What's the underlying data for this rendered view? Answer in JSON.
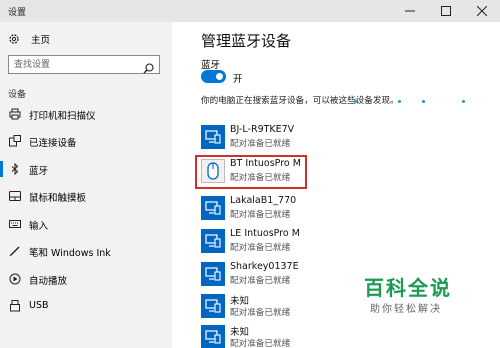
{
  "window": {
    "title": "设置"
  },
  "sidebar": {
    "home_label": "主页",
    "search_placeholder": "查找设置",
    "section_label": "设备",
    "items": [
      {
        "label": "打印机和扫描仪",
        "icon": "printer-icon"
      },
      {
        "label": "已连接设备",
        "icon": "connected-devices-icon"
      },
      {
        "label": "蓝牙",
        "icon": "bluetooth-icon",
        "active": true
      },
      {
        "label": "鼠标和触摸板",
        "icon": "mouse-touchpad-icon"
      },
      {
        "label": "输入",
        "icon": "keyboard-icon"
      },
      {
        "label": "笔和 Windows Ink",
        "icon": "pen-icon"
      },
      {
        "label": "自动播放",
        "icon": "autoplay-icon"
      },
      {
        "label": "USB",
        "icon": "usb-icon"
      }
    ]
  },
  "main": {
    "heading": "管理蓝牙设备",
    "bluetooth_label": "蓝牙",
    "toggle_state": "开",
    "toggle_on": true,
    "description": "你的电脑正在搜索蓝牙设备，可以被这些设备发现。",
    "devices": [
      {
        "name": "BJ-L-R9TKE7V",
        "status": "配对准备已就绪",
        "icon": "computer-device-icon"
      },
      {
        "name": "BT IntuosPro M",
        "status": "配对准备已就绪",
        "icon": "mouse-device-icon",
        "highlighted": true
      },
      {
        "name": "LakalaB1_770",
        "status": "配对准备已就绪",
        "icon": "computer-device-icon"
      },
      {
        "name": "LE IntuosPro M",
        "status": "配对准备已就绪",
        "icon": "computer-device-icon"
      },
      {
        "name": "Sharkey0137E",
        "status": "配对准备已就绪",
        "icon": "computer-device-icon"
      },
      {
        "name": "未知",
        "status": "配对准备已就绪",
        "icon": "computer-device-icon"
      },
      {
        "name": "未知",
        "status": "配对准备已就绪",
        "icon": "computer-device-icon"
      }
    ]
  },
  "watermark": {
    "title": "百科全说",
    "subtitle": "助你轻松解决"
  },
  "colors": {
    "accent": "#0078d7",
    "tile": "#0067c0",
    "highlight": "#d0312d",
    "watermark": "#1b9a52"
  }
}
